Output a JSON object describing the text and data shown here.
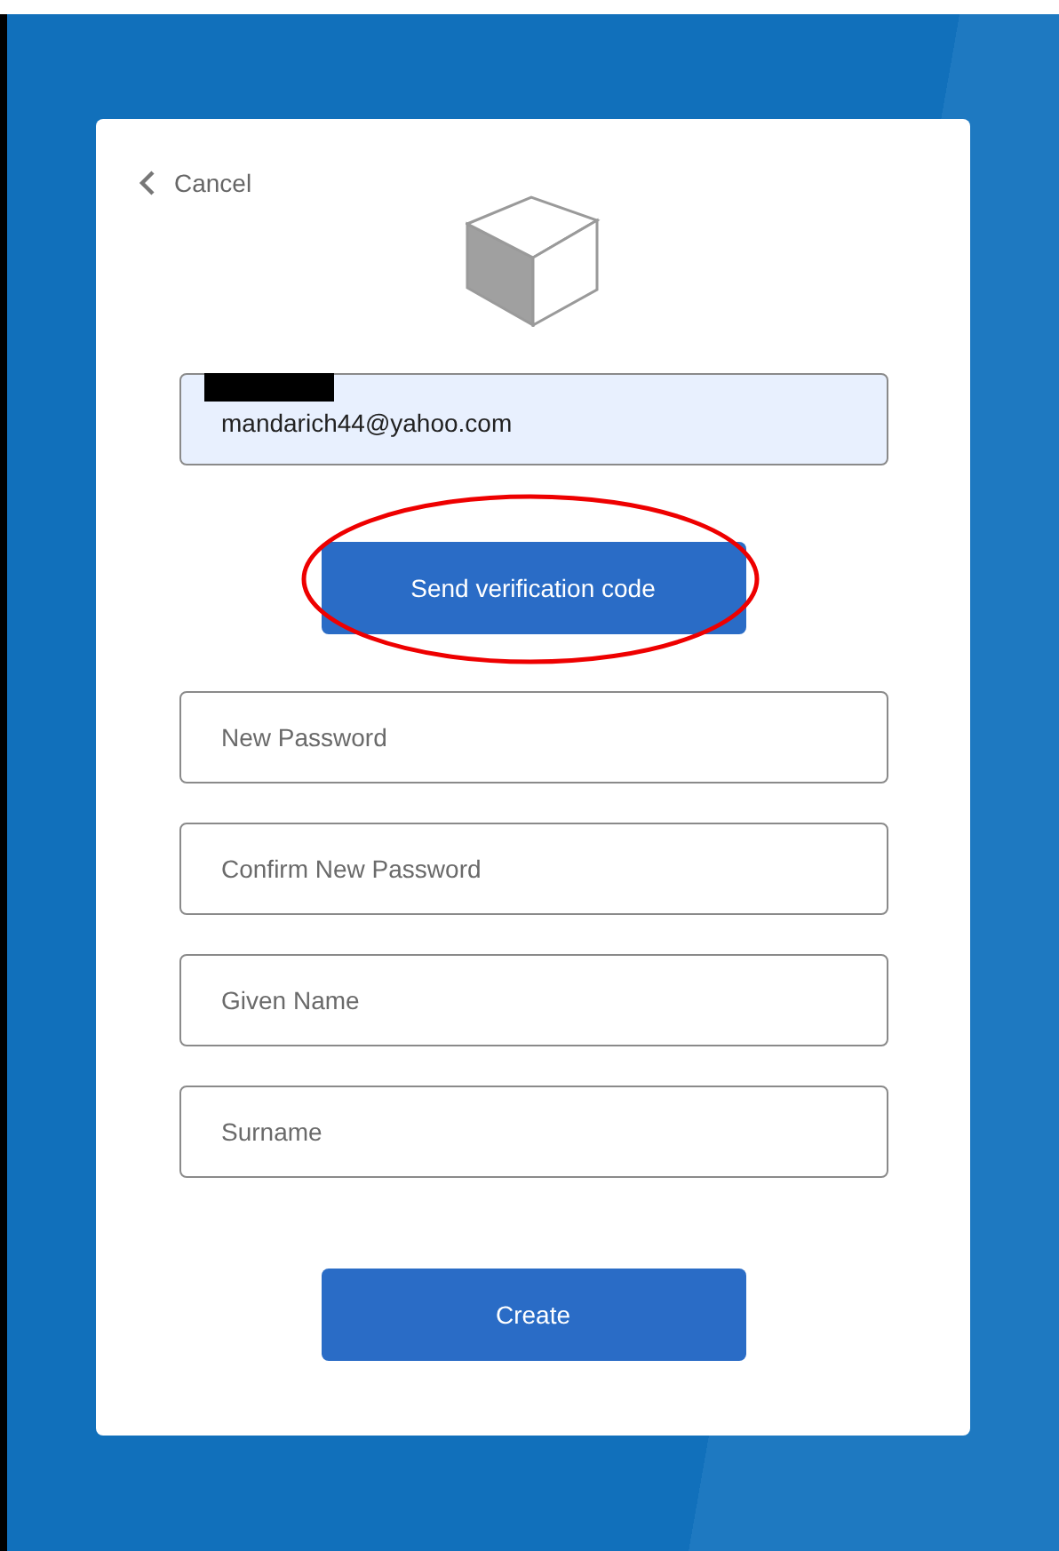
{
  "cancel": {
    "label": "Cancel"
  },
  "email_field": {
    "value": "mandarich44@yahoo.com"
  },
  "send_code_button": {
    "label": "Send verification code"
  },
  "fields": [
    {
      "placeholder": "New Password"
    },
    {
      "placeholder": "Confirm New Password"
    },
    {
      "placeholder": "Given Name"
    },
    {
      "placeholder": "Surname"
    }
  ],
  "create_button": {
    "label": "Create"
  }
}
